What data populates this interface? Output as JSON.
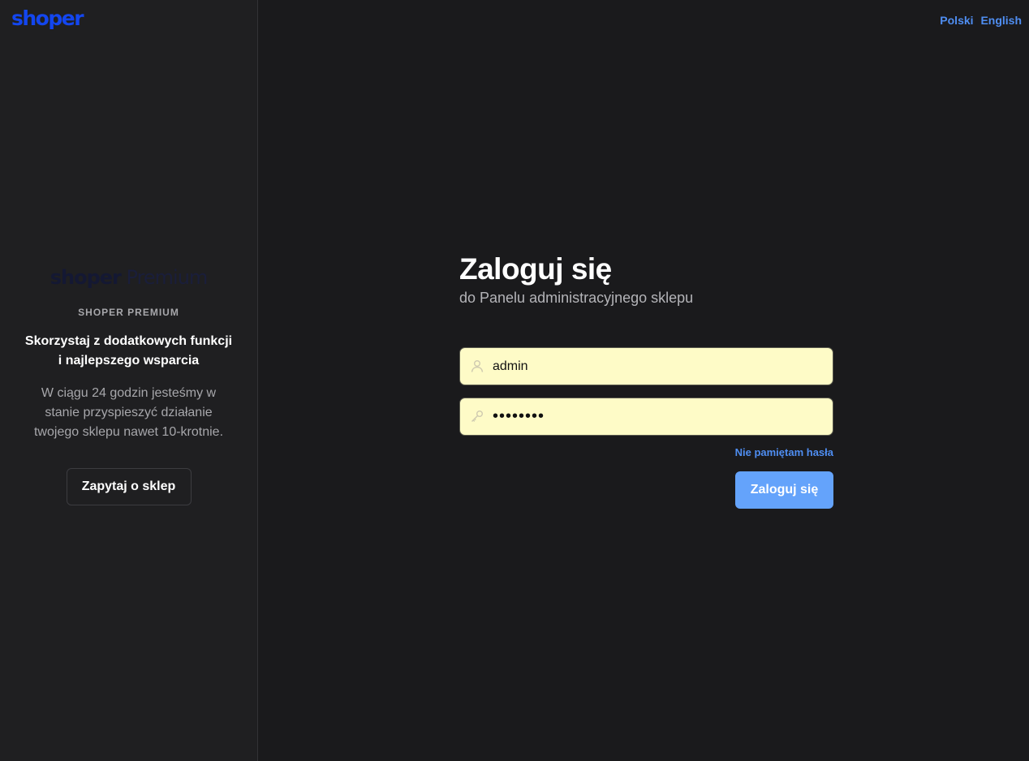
{
  "sidebar": {
    "logo": "shoper",
    "promo": {
      "logo_brand": "shoper",
      "logo_tier": "Premium",
      "eyebrow": "SHOPER PREMIUM",
      "heading": "Skorzystaj z dodatkowych funkcji i najlepszego wsparcia",
      "body": "W ciągu 24 godzin jesteśmy w stanie przyspieszyć działanie twojego sklepu nawet 10-krotnie.",
      "button_label": "Zapytaj o sklep"
    }
  },
  "language": {
    "options": [
      "Polski",
      "English"
    ]
  },
  "login": {
    "title": "Zaloguj się",
    "subtitle": "do Panelu administracyjnego sklepu",
    "username": {
      "value": "admin",
      "icon": "user-icon"
    },
    "password": {
      "value": "••••••••",
      "icon": "key-icon"
    },
    "forgot_link": "Nie pamiętam hasła",
    "submit_label": "Zaloguj się"
  },
  "colors": {
    "brand": "#1346f0",
    "link": "#4f8ef2",
    "primary_button": "#64a3fb",
    "input_autofill": "#fefbc7"
  }
}
